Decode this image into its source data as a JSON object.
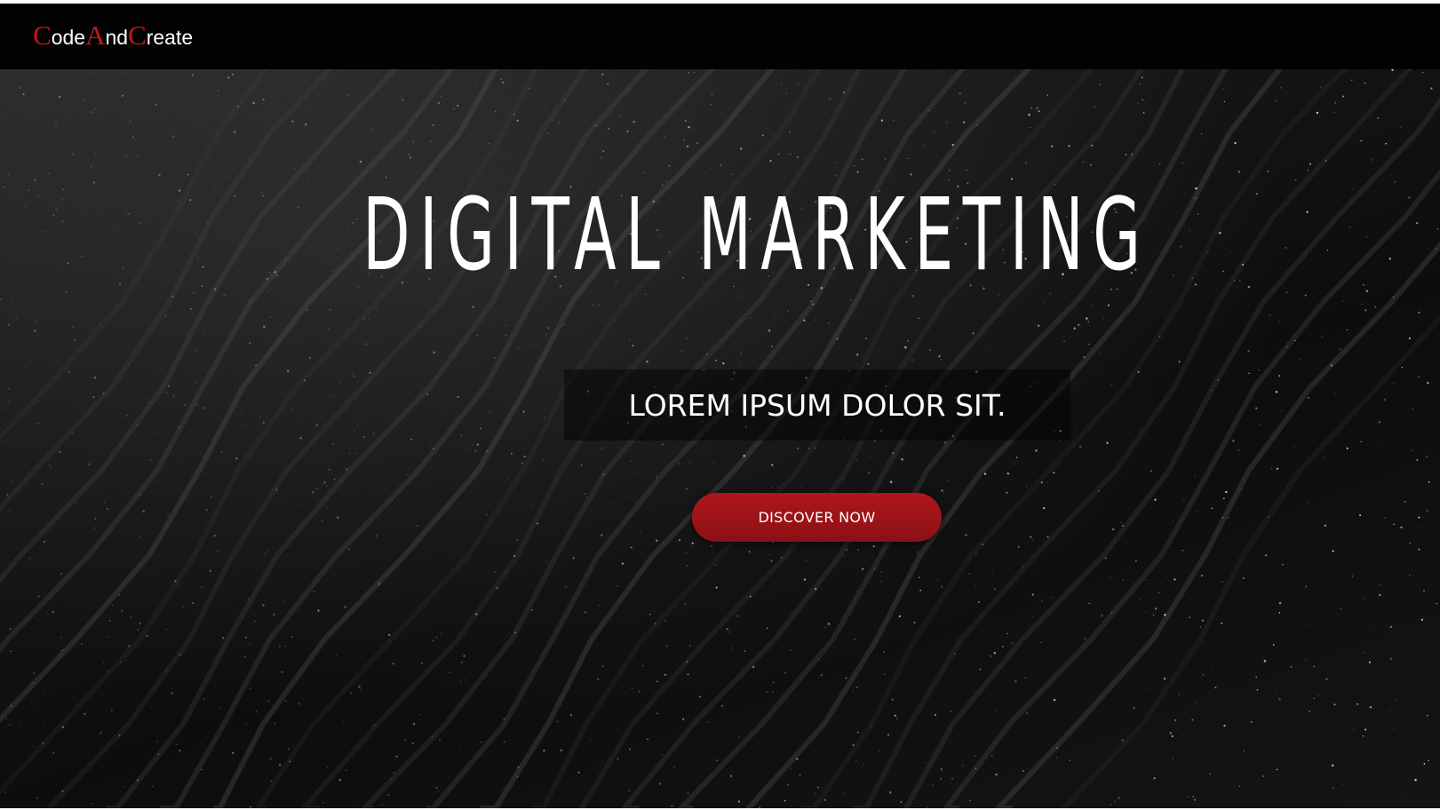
{
  "navbar": {
    "logo": [
      {
        "text": "C",
        "accent": true
      },
      {
        "text": "ode",
        "accent": false
      },
      {
        "text": "A",
        "accent": true
      },
      {
        "text": "nd",
        "accent": false
      },
      {
        "text": "C",
        "accent": true
      },
      {
        "text": "reate",
        "accent": false
      }
    ]
  },
  "hero": {
    "headline": "DIGITAL MARKETING",
    "tagline": "LOREM IPSUM DOLOR SIT.",
    "cta_label": "DISCOVER NOW"
  },
  "colors": {
    "accent": "#c4161c",
    "button": "#a0141a",
    "navbar": "#020202",
    "text": "#ffffff"
  }
}
